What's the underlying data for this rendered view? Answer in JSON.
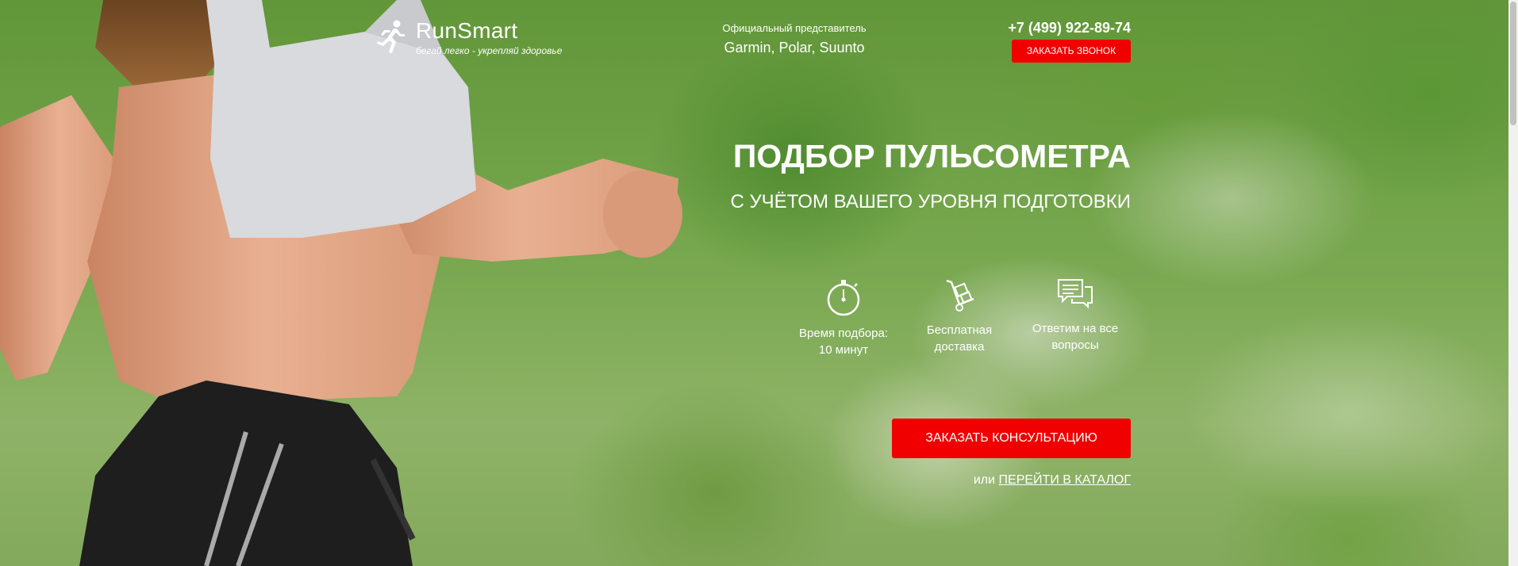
{
  "header": {
    "logo_name": "RunSmart",
    "logo_slogan": "бегай легко - укрепляй здоровье",
    "logo_icon": "runner-icon",
    "rep_label": "Официальный представитель",
    "rep_brands": "Garmin, Polar, Suunto",
    "phone": "+7 (499) 922-89-74",
    "call_button": "ЗАКАЗАТЬ ЗВОНОК"
  },
  "main": {
    "title": "ПОДБОР ПУЛЬСОМЕТРА",
    "subtitle": "С УЧЁТОМ ВАШЕГО УРОВНЯ ПОДГОТОВКИ",
    "features": [
      {
        "icon": "stopwatch-icon",
        "line1": "Время подбора:",
        "line2": "10 минут"
      },
      {
        "icon": "hand-truck-icon",
        "line1": "Бесплатная",
        "line2": "доставка"
      },
      {
        "icon": "chat-bubbles-icon",
        "line1": "Ответим на все",
        "line2": "вопросы"
      }
    ],
    "consult_button": "ЗАКАЗАТЬ КОНСУЛЬТАЦИЮ",
    "catalog_prefix": "или",
    "catalog_link": "ПЕРЕЙТИ В КАТАЛОГ"
  },
  "colors": {
    "accent": "#f00000",
    "text": "#ffffff"
  }
}
